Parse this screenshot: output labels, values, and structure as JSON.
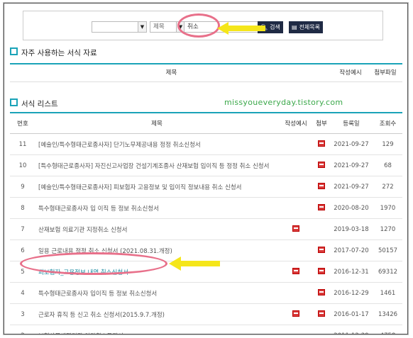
{
  "search": {
    "select1_value": "",
    "select2_value": "제목",
    "keyword_value": "취소",
    "search_button": "검색",
    "list_button": "전체목록"
  },
  "frequent": {
    "title": "자주 사용하는 서식 자료",
    "columns": [
      "제목",
      "작성예시",
      "첨부파일"
    ]
  },
  "forms": {
    "title": "서식 리스트",
    "columns": [
      "번호",
      "제목",
      "작성예시",
      "첨부",
      "등록일",
      "조회수"
    ],
    "rows": [
      {
        "no": "11",
        "title": "[예술인/특수형태근로종사자] 단기노무제공내용 정정 취소신청서",
        "example": false,
        "attach": true,
        "date": "2021-09-27",
        "views": "129"
      },
      {
        "no": "10",
        "title": "[특수형태근로종사자] 자진신고사업장 건설기계조종사 산재보험 입이직 등 정정 취소 신청서",
        "example": false,
        "attach": true,
        "date": "2021-09-27",
        "views": "68"
      },
      {
        "no": "9",
        "title": "[예술인/특수형태근로종사자] 피보험자 고용정보 및 입이직 정보내용 취소 신청서",
        "example": false,
        "attach": true,
        "date": "2021-09-27",
        "views": "272"
      },
      {
        "no": "8",
        "title": "특수형태근로종사자 입 이직 등 정보 취소신청서",
        "example": false,
        "attach": true,
        "date": "2020-08-20",
        "views": "1970"
      },
      {
        "no": "7",
        "title": "산재보험 의료기관 지정취소 신청서",
        "example": true,
        "attach": false,
        "date": "2019-03-18",
        "views": "1270"
      },
      {
        "no": "6",
        "title": "일용 근로내용 정정 취소 신청서 (2021.08.31.개정)",
        "example": false,
        "attach": true,
        "date": "2017-07-20",
        "views": "50157"
      },
      {
        "no": "5",
        "title": "피보험자_고용정보 내역 취소신청서",
        "example": true,
        "attach": true,
        "date": "2016-12-31",
        "views": "69312",
        "highlight": true
      },
      {
        "no": "4",
        "title": "특수형태근로종사자 입이직 등 정보 취소신청서",
        "example": false,
        "attach": true,
        "date": "2016-12-29",
        "views": "1461"
      },
      {
        "no": "3",
        "title": "근로자 휴직 등 신고 취소 신청서(2015.9.7.개정)",
        "example": true,
        "attach": true,
        "date": "2016-01-17",
        "views": "13426"
      },
      {
        "no": "2",
        "title": "보험사무대행기관 인가취소통지서",
        "example": false,
        "attach": false,
        "date": "2011-12-29",
        "views": "4758"
      }
    ]
  },
  "watermark": "missyoueveryday.tistory.com",
  "colors": {
    "accent": "#1aa3b8",
    "button": "#1f2a44",
    "highlight": "#e8708a",
    "arrow": "#f5e61a",
    "file_icon": "#d93a3a"
  }
}
